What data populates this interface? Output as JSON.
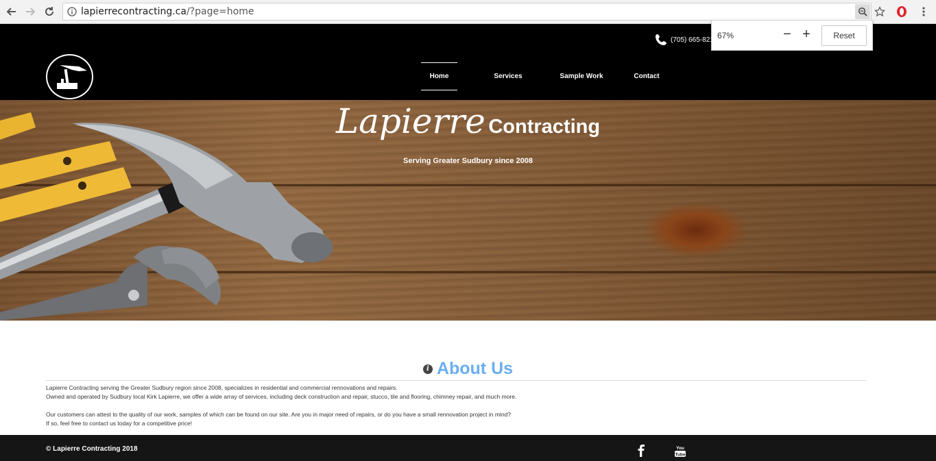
{
  "browser": {
    "url_host": "lapierrecontracting.ca",
    "url_path": "/?page=home",
    "zoom_popup": {
      "percent": "67%",
      "minus": "−",
      "plus": "+",
      "reset": "Reset"
    }
  },
  "header": {
    "phone": "(705) 665-8210",
    "nav": [
      "Home",
      "Services",
      "Sample Work",
      "Contact"
    ],
    "active_nav": "Home"
  },
  "hero": {
    "title_script": "Lapierre",
    "title_bold": "Contracting",
    "subtitle": "Serving Greater Sudbury since 2008"
  },
  "about": {
    "title": "About Us",
    "p1": "Lapierre Contracting serving the Greater Sudbury region since 2008, specializes in residential and commercial rennovations and repairs.",
    "p2": "Owned and operated by Sudbury local Kirk Lapierre, we offer a wide array of services, including deck construction and repair, stucco, tile and flooring, chimney repair, and much more.",
    "p3": "Our customers can attest to the quality of our work, samples of which can be found on our site. Are you in major need of repairs, or do you have a small rennovation project in mind?",
    "p4": "If so, feel free to contact us today for a competitive price!"
  },
  "footer": {
    "copyright": "© Lapierre Contracting 2018",
    "social_icons": [
      "facebook-icon",
      "youtube-icon"
    ],
    "youtube_label": "You Tube"
  },
  "colors": {
    "header_bg": "#000000",
    "accent_blue": "#6aaef0",
    "footer_bg": "#151515"
  }
}
